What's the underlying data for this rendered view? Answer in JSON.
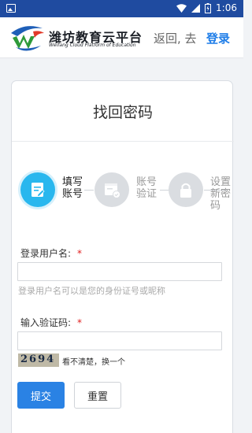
{
  "status_bar": {
    "time": "1:06"
  },
  "header": {
    "brand_title": "潍坊教育云平台",
    "brand_subtitle": "Weifang Cloud Platform of Education",
    "back_text": "返回, 去",
    "login_link": "登录"
  },
  "card": {
    "title": "找回密码",
    "steps": [
      {
        "label": "填写账号",
        "state": "active"
      },
      {
        "label": "账号验证",
        "state": "inactive"
      },
      {
        "label": "设置新密码",
        "state": "inactive"
      }
    ],
    "username": {
      "label": "登录用户名:",
      "required_mark": "*",
      "value": "",
      "hint": "登录用户名可以是您的身份证号或昵称"
    },
    "captcha": {
      "label": "输入验证码:",
      "required_mark": "*",
      "value": "",
      "code_image_text": "2694",
      "refresh_text": "看不清楚，换一个"
    },
    "buttons": {
      "submit": "提交",
      "reset": "重置"
    }
  },
  "colors": {
    "primary": "#2a82e4",
    "status_bar": "#1f4ba0",
    "step_active": "#29b7ee",
    "step_inactive": "#dadde1",
    "required": "#e02020"
  }
}
